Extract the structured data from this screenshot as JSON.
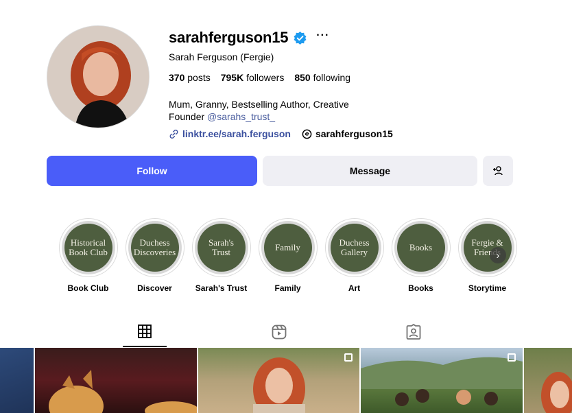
{
  "profile": {
    "username": "sarahferguson15",
    "more_label": "···",
    "full_name": "Sarah Ferguson (Fergie)",
    "stats": {
      "posts_count": "370",
      "posts_label": "posts",
      "followers_count": "795K",
      "followers_label": "followers",
      "following_count": "850",
      "following_label": "following"
    },
    "bio_line1": "Mum, Granny, Bestselling Author, Creative",
    "bio_line2_prefix": "Founder",
    "bio_mention": "@sarahs_trust_",
    "link_text": "linktr.ee/sarah.ferguson",
    "threads_handle": "sarahferguson15"
  },
  "actions": {
    "follow_label": "Follow",
    "message_label": "Message",
    "suggest_icon": "add-person-icon"
  },
  "highlights": [
    {
      "cover_text": "Historical\nBook Club",
      "label": "Book Club"
    },
    {
      "cover_text": "Duchess\nDiscoveries",
      "label": "Discover"
    },
    {
      "cover_text": "Sarah's\nTrust",
      "label": "Sarah's Trust"
    },
    {
      "cover_text": "Family",
      "label": "Family"
    },
    {
      "cover_text": "Duchess\nGallery",
      "label": "Art"
    },
    {
      "cover_text": "Books",
      "label": "Books"
    },
    {
      "cover_text": "Fergie &\nFriends",
      "label": "Storytime"
    }
  ],
  "tabs": [
    {
      "icon": "grid-icon",
      "active": true
    },
    {
      "icon": "reels-icon",
      "active": false
    },
    {
      "icon": "tagged-icon",
      "active": false
    }
  ],
  "colors": {
    "accent": "#4a5df9",
    "link": "#3a4f9e",
    "verified": "#1d9bf0",
    "highlight_bg": "#4e5e3f",
    "button_secondary": "#efeff4"
  }
}
